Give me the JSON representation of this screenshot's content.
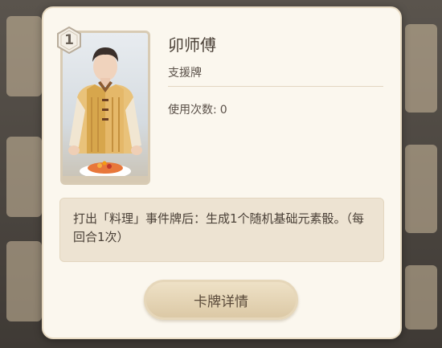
{
  "card": {
    "cost": "1",
    "name": "卯师傅",
    "type": "支援牌",
    "usage_label": "使用次数:",
    "usage_count": "0",
    "description": "打出「料理」事件牌后：生成1个随机基础元素骰。（每回合1次）"
  },
  "actions": {
    "detail_button": "卡牌详情"
  },
  "colors": {
    "dialog_bg": "#fbf7ee",
    "desc_bg": "#ede3d2",
    "button_bg": "#dcc9a6",
    "text": "#4a4037"
  },
  "icons": {
    "cost_badge": "dice-cost-icon",
    "portrait": "character-portrait"
  }
}
